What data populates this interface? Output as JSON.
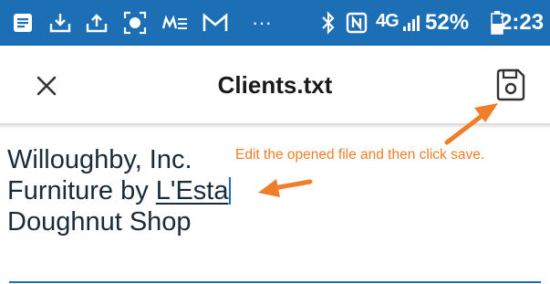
{
  "status_bar": {
    "icons": [
      "notes-icon",
      "download-icon",
      "upload-icon",
      "record-icon",
      "mail-app-icon",
      "gmail-icon",
      "more-dots-icon",
      "bluetooth-icon",
      "nfc-icon",
      "network-4g-icon",
      "signal-icon",
      "battery-icon"
    ],
    "more_dots": "···",
    "network_label": "4G",
    "battery_percent": "52%",
    "time": "2:23",
    "bg_color": "#1d6fb5"
  },
  "app_bar": {
    "title": "Clients.txt",
    "close_icon": "close-icon",
    "save_icon": "save-icon"
  },
  "editor": {
    "lines": [
      "Willoughby, Inc.",
      "Furniture by ",
      "Doughnut Shop"
    ],
    "underlined_word": "L'Esta",
    "accent_color": "#1d6fb5"
  },
  "annotation": {
    "text": "Edit the opened file and then click save.",
    "color": "#f07d2a"
  }
}
